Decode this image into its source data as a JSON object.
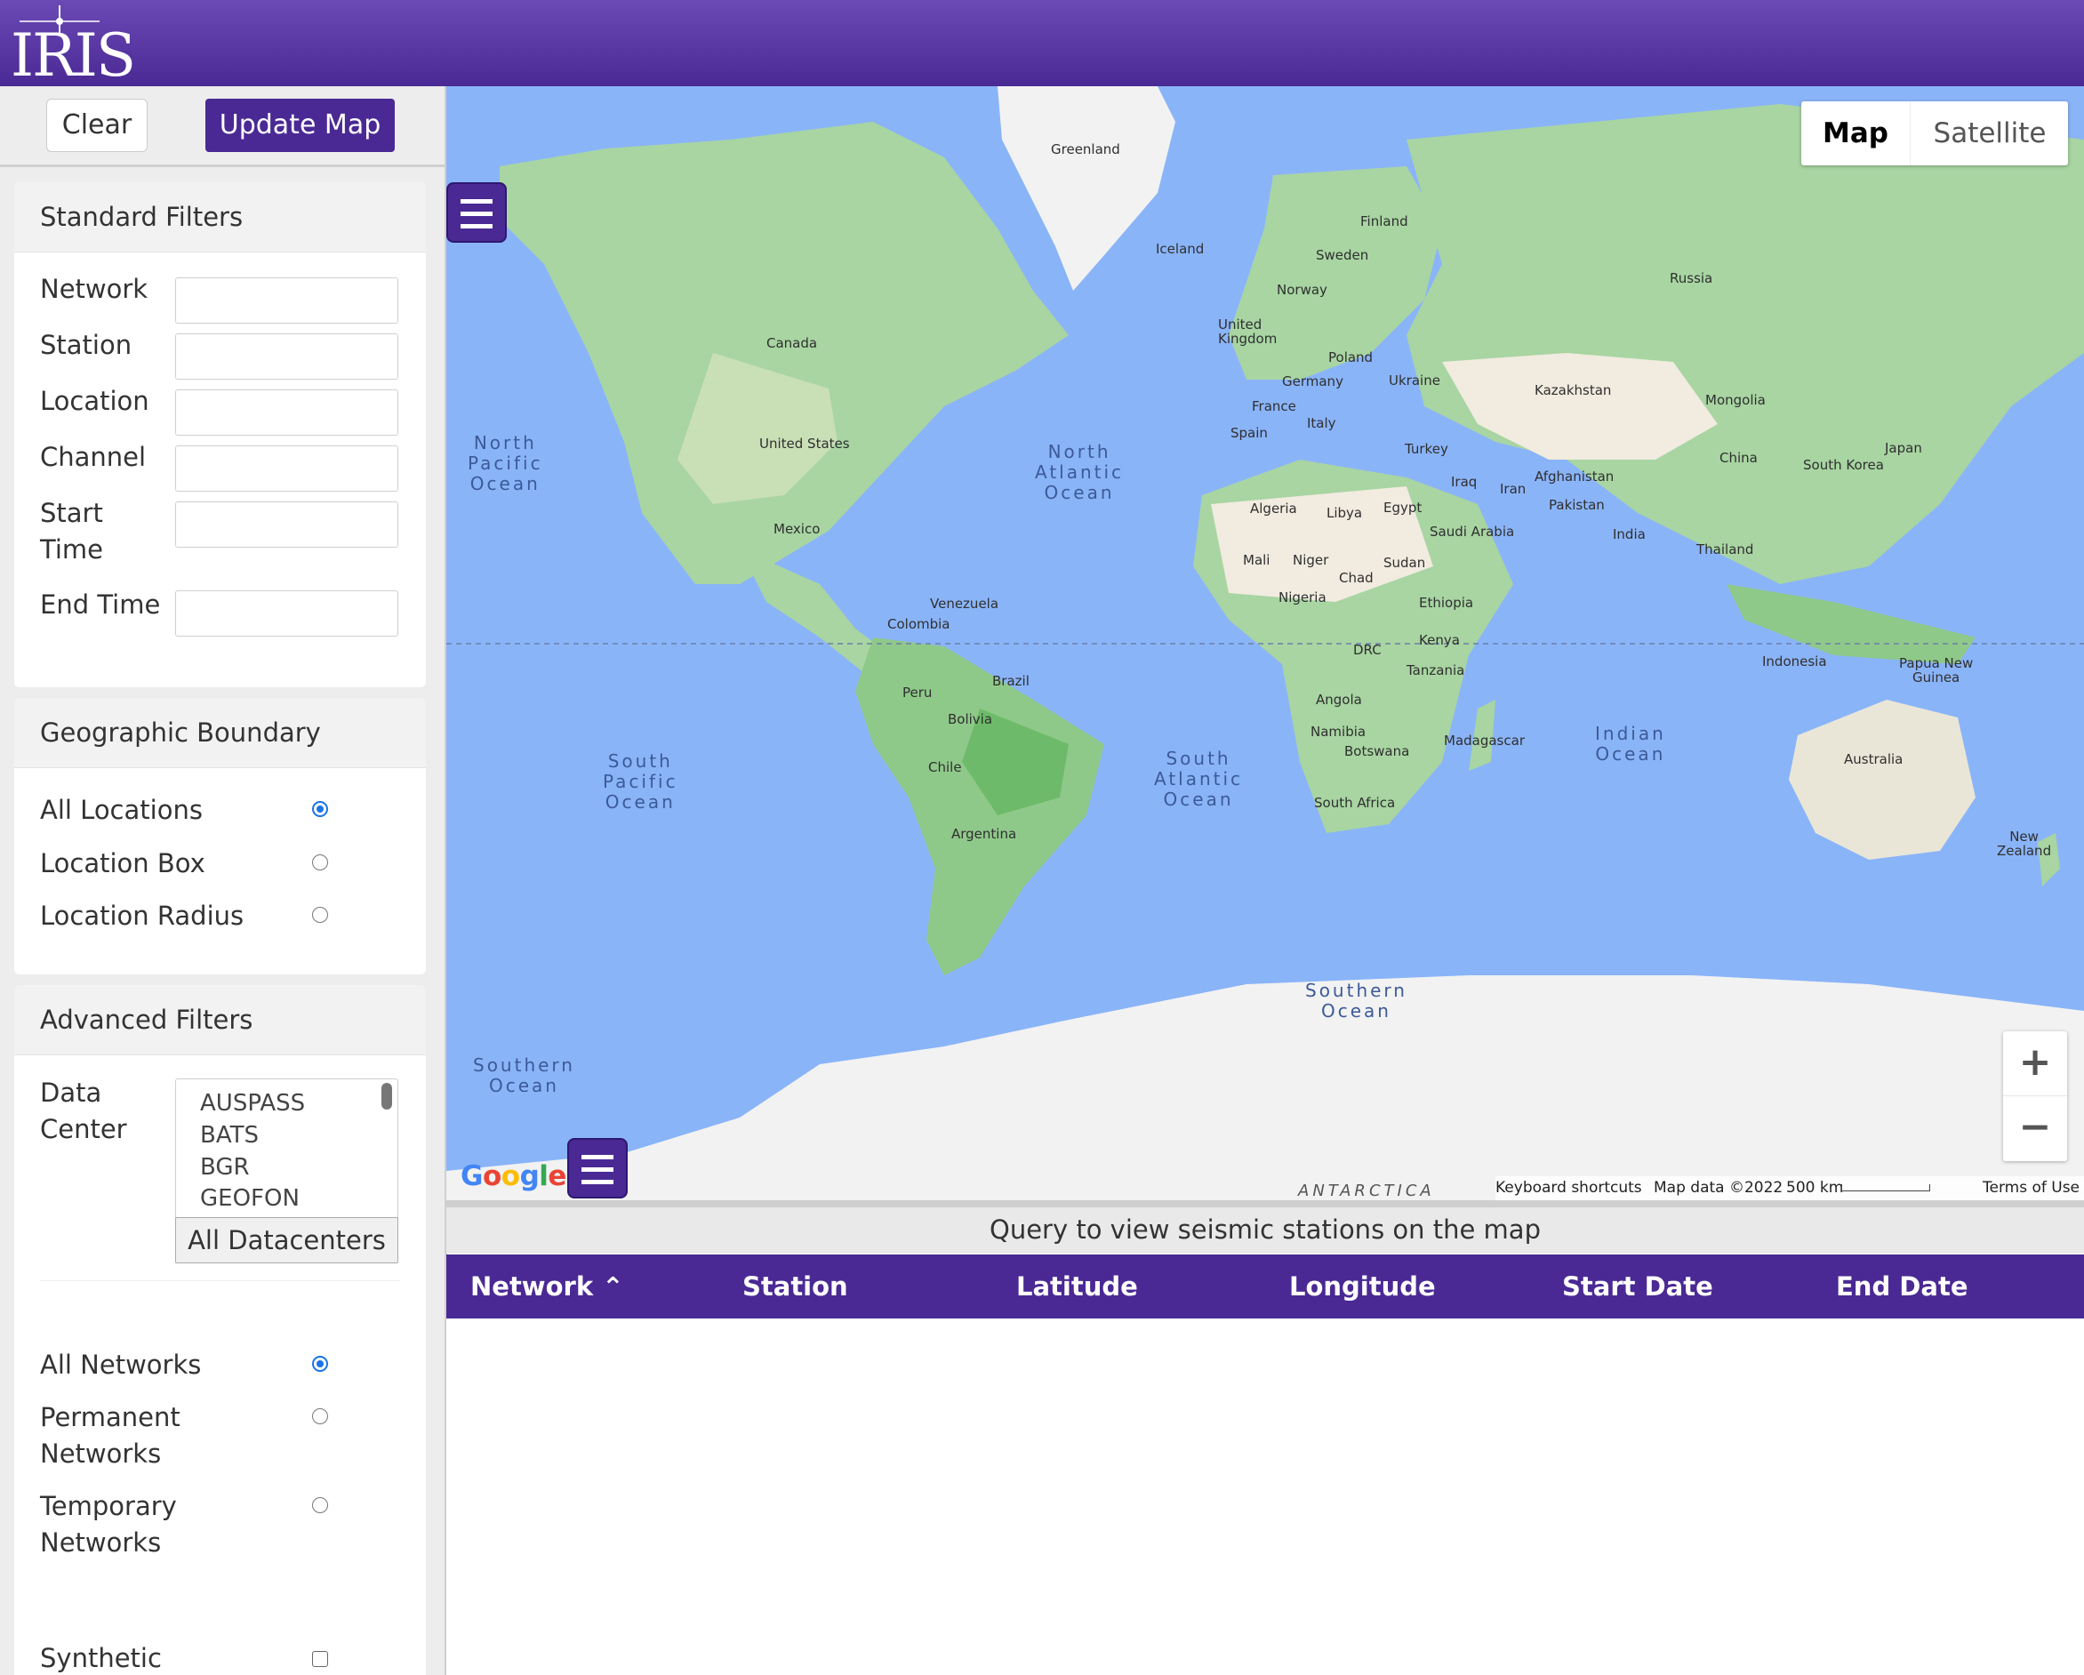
{
  "header": {
    "logo_text": "IRIS"
  },
  "sidebar": {
    "clear_label": "Clear",
    "update_label": "Update Map",
    "standard": {
      "title": "Standard Filters",
      "network": "Network",
      "station": "Station",
      "location": "Location",
      "channel": "Channel",
      "start_time_1": "Start",
      "start_time_2": "Time",
      "end_time": "End Time"
    },
    "geo": {
      "title": "Geographic Boundary",
      "all_locations": "All Locations",
      "location_box": "Location Box",
      "location_radius": "Location Radius",
      "selected": "All Locations"
    },
    "advanced": {
      "title": "Advanced Filters",
      "data_center_1": "Data",
      "data_center_2": "Center",
      "datacenters": [
        "AUSPASS",
        "BATS",
        "BGR",
        "GEOFON"
      ],
      "all_datacenters": "All Datacenters",
      "all_networks": "All Networks",
      "permanent_1": "Permanent",
      "permanent_2": "Networks",
      "temporary_1": "Temporary",
      "temporary_2": "Networks",
      "synthetic": "Synthetic",
      "selected_network": "All Networks"
    }
  },
  "map": {
    "type_map": "Map",
    "type_satellite": "Satellite",
    "zoom_in": "+",
    "zoom_out": "−",
    "google": "Google",
    "footer": {
      "shortcuts": "Keyboard shortcuts",
      "data": "Map data ©2022",
      "scale": "500 km",
      "terms": "Terms of Use"
    },
    "antarctica": "ANTARCTICA",
    "oceans": {
      "north_pacific": [
        "North",
        "Pacific",
        "Ocean"
      ],
      "north_atlantic": [
        "North",
        "Atlantic",
        "Ocean"
      ],
      "south_pacific": [
        "South",
        "Pacific",
        "Ocean"
      ],
      "south_atlantic": [
        "South",
        "Atlantic",
        "Ocean"
      ],
      "indian": [
        "Indian",
        "Ocean"
      ],
      "southern_left": [
        "Southern",
        "Ocean"
      ],
      "southern_mid": [
        "Southern",
        "Ocean"
      ]
    },
    "countries": {
      "greenland": "Greenland",
      "iceland": "Iceland",
      "finland": "Finland",
      "sweden": "Sweden",
      "norway": "Norway",
      "russia": "Russia",
      "united_kingdom_1": "United",
      "united_kingdom_2": "Kingdom",
      "poland": "Poland",
      "germany": "Germany",
      "ukraine": "Ukraine",
      "france": "France",
      "italy": "Italy",
      "spain": "Spain",
      "kazakhstan": "Kazakhstan",
      "mongolia": "Mongolia",
      "turkey": "Turkey",
      "iraq": "Iraq",
      "iran": "Iran",
      "afghanistan": "Afghanistan",
      "pakistan": "Pakistan",
      "china": "China",
      "south_korea": "South Korea",
      "japan": "Japan",
      "india": "India",
      "thailand": "Thailand",
      "canada": "Canada",
      "united_states": "United States",
      "mexico": "Mexico",
      "algeria": "Algeria",
      "libya": "Libya",
      "egypt": "Egypt",
      "saudi_arabia": "Saudi Arabia",
      "mali": "Mali",
      "niger": "Niger",
      "chad": "Chad",
      "sudan": "Sudan",
      "nigeria": "Nigeria",
      "ethiopia": "Ethiopia",
      "venezuela": "Venezuela",
      "colombia": "Colombia",
      "kenya": "Kenya",
      "drc": "DRC",
      "tanzania": "Tanzania",
      "indonesia": "Indonesia",
      "papua_1": "Papua New",
      "papua_2": "Guinea",
      "peru": "Peru",
      "brazil": "Brazil",
      "bolivia": "Bolivia",
      "angola": "Angola",
      "namibia": "Namibia",
      "botswana": "Botswana",
      "madagascar": "Madagascar",
      "chile": "Chile",
      "south_africa": "South Africa",
      "australia": "Australia",
      "argentina": "Argentina",
      "new_zealand_1": "New",
      "new_zealand_2": "Zealand"
    }
  },
  "status": "Query to view seismic stations on the map",
  "table": {
    "columns": [
      "Network",
      "Station",
      "Latitude",
      "Longitude",
      "Start Date",
      "End Date"
    ],
    "sort_indicator": "⌃",
    "rows": []
  },
  "colors": {
    "brand": "#4a2994",
    "ocean": "#8ab4f8",
    "land": "#a8d5a2",
    "ice": "#f2f2f2",
    "desert": "#f1ebe0"
  }
}
